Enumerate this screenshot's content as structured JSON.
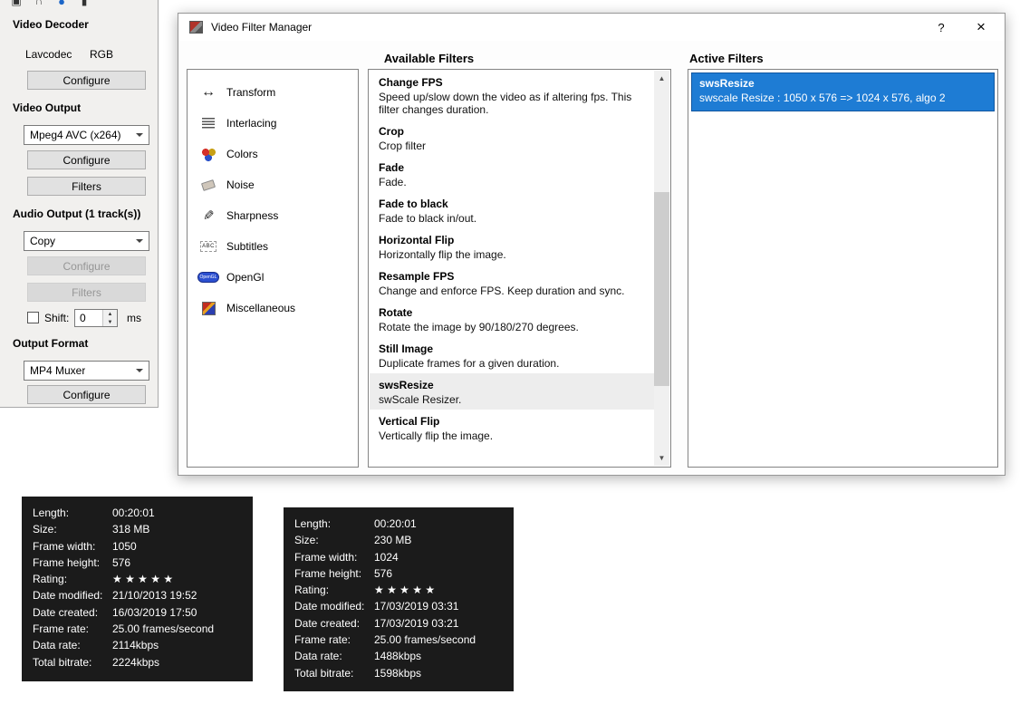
{
  "colors": {
    "selection_blue": "#1e7cd4",
    "tooltip_bg": "#1b1b1b"
  },
  "toolbar": {
    "icons": [
      {
        "name": "display-icon"
      },
      {
        "name": "magnet-icon"
      },
      {
        "name": "record-icon"
      },
      {
        "name": "volume-icon"
      }
    ]
  },
  "sidebar": {
    "video_decoder": {
      "title": "Video Decoder",
      "codec": "Lavcodec",
      "mode": "RGB",
      "configure": "Configure"
    },
    "video_output": {
      "title": "Video Output",
      "selected": "Mpeg4 AVC (x264)",
      "configure": "Configure",
      "filters": "Filters"
    },
    "audio_output": {
      "title": "Audio Output (1 track(s))",
      "selected": "Copy",
      "configure": "Configure",
      "filters": "Filters",
      "shift_label": "Shift:",
      "shift_value": "0",
      "shift_unit": "ms"
    },
    "output_format": {
      "title": "Output Format",
      "selected": "MP4 Muxer",
      "configure": "Configure"
    }
  },
  "dialog": {
    "title": "Video Filter Manager",
    "help": "?",
    "close": "×",
    "available_header": "Available Filters",
    "active_header": "Active Filters",
    "categories": [
      {
        "label": "Transform",
        "icon": "transform-icon"
      },
      {
        "label": "Interlacing",
        "icon": "interlacing-icon"
      },
      {
        "label": "Colors",
        "icon": "colors-icon"
      },
      {
        "label": "Noise",
        "icon": "noise-icon"
      },
      {
        "label": "Sharpness",
        "icon": "sharpness-icon"
      },
      {
        "label": "Subtitles",
        "icon": "subtitles-icon"
      },
      {
        "label": "OpenGl",
        "icon": "opengl-icon"
      },
      {
        "label": "Miscellaneous",
        "icon": "misc-icon"
      }
    ],
    "filters": [
      {
        "name": "Change FPS",
        "desc": "Speed up/slow down the video as if altering fps. This filter changes duration.",
        "selected": false
      },
      {
        "name": "Crop",
        "desc": "Crop filter",
        "selected": false
      },
      {
        "name": "Fade",
        "desc": "Fade.",
        "selected": false
      },
      {
        "name": "Fade to black",
        "desc": "Fade to black in/out.",
        "selected": false
      },
      {
        "name": "Horizontal Flip",
        "desc": "Horizontally flip the image.",
        "selected": false
      },
      {
        "name": "Resample FPS",
        "desc": "Change and enforce FPS. Keep duration and sync.",
        "selected": false
      },
      {
        "name": "Rotate",
        "desc": "Rotate the image by 90/180/270 degrees.",
        "selected": false
      },
      {
        "name": "Still Image",
        "desc": "Duplicate frames for a given duration.",
        "selected": false
      },
      {
        "name": "swsResize",
        "desc": "swScale Resizer.",
        "selected": true
      },
      {
        "name": "Vertical Flip",
        "desc": "Vertically flip the image.",
        "selected": false
      }
    ],
    "active_filters": [
      {
        "name": "swsResize",
        "desc": "swscale Resize : 1050 x 576  => 1024 x 576, algo 2"
      }
    ]
  },
  "tooltips": [
    {
      "rows": [
        {
          "label": "Length:",
          "value": "00:20:01"
        },
        {
          "label": "Size:",
          "value": "318 MB"
        },
        {
          "label": "Frame width:",
          "value": "1050"
        },
        {
          "label": "Frame height:",
          "value": "576"
        },
        {
          "label": "Rating:",
          "value": "★ ★ ★ ★ ★"
        },
        {
          "label": "Date modified:",
          "value": "21/10/2013 19:52"
        },
        {
          "label": "Date created:",
          "value": "16/03/2019 17:50"
        },
        {
          "label": "Frame rate:",
          "value": "25.00 frames/second"
        },
        {
          "label": "Data rate:",
          "value": "2114kbps"
        },
        {
          "label": "Total bitrate:",
          "value": "2224kbps"
        }
      ]
    },
    {
      "rows": [
        {
          "label": "Length:",
          "value": "00:20:01"
        },
        {
          "label": "Size:",
          "value": "230 MB"
        },
        {
          "label": "Frame width:",
          "value": "1024"
        },
        {
          "label": "Frame height:",
          "value": "576"
        },
        {
          "label": "Rating:",
          "value": "★ ★ ★ ★ ★"
        },
        {
          "label": "Date modified:",
          "value": "17/03/2019 03:31"
        },
        {
          "label": "Date created:",
          "value": "17/03/2019 03:21"
        },
        {
          "label": "Frame rate:",
          "value": "25.00 frames/second"
        },
        {
          "label": "Data rate:",
          "value": "1488kbps"
        },
        {
          "label": "Total bitrate:",
          "value": "1598kbps"
        }
      ]
    }
  ]
}
